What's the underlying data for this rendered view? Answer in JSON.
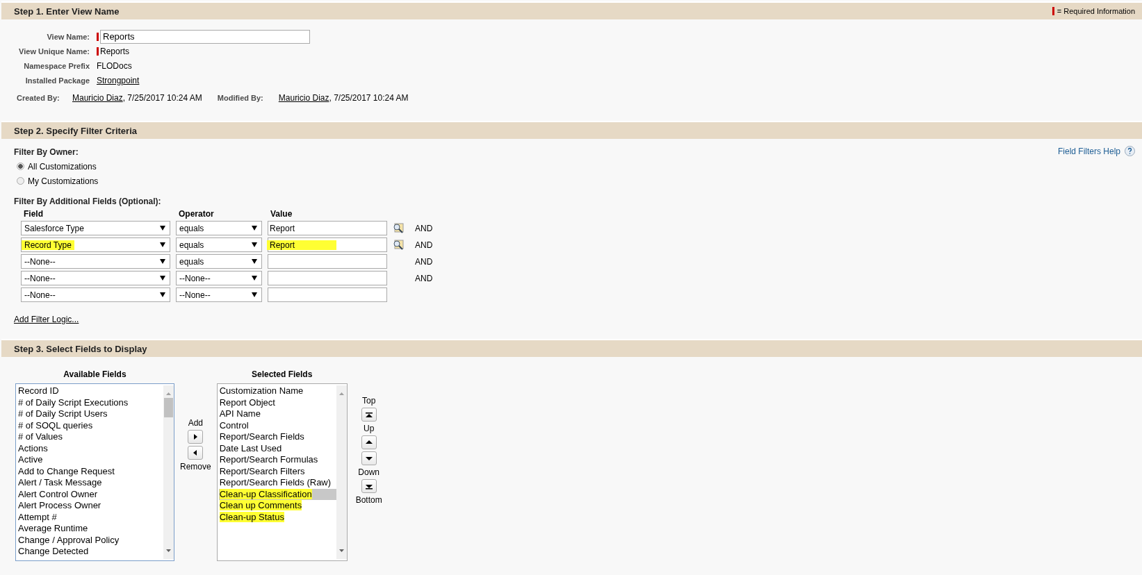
{
  "required_legend": "= Required Information",
  "step1": {
    "title": "Step 1. Enter View Name",
    "fields": [
      {
        "label": "View Name:",
        "kind": "input",
        "value": "Reports",
        "required": true
      },
      {
        "label": "View Unique Name:",
        "kind": "text",
        "value": "Reports",
        "required": true
      },
      {
        "label": "Namespace Prefix",
        "kind": "text",
        "value": "FLODocs",
        "required": false
      },
      {
        "label": "Installed Package",
        "kind": "link",
        "value": "Strongpoint",
        "required": false
      }
    ],
    "audit": [
      {
        "label": "Created By:",
        "user": "Mauricio Diaz",
        "date": ", 7/25/2017 10:24 AM"
      },
      {
        "label": "Modified By:",
        "user": "Mauricio Diaz",
        "date": ", 7/25/2017 10:24 AM"
      }
    ]
  },
  "step2": {
    "title": "Step 2. Specify Filter Criteria",
    "help_link": "Field Filters Help",
    "owner_label": "Filter By Owner:",
    "owner_options": [
      {
        "label": "All Customizations",
        "selected": true
      },
      {
        "label": "My Customizations",
        "selected": false
      }
    ],
    "additional_label": "Filter By Additional Fields (Optional):",
    "columns": [
      "Field",
      "Operator",
      "Value"
    ],
    "rows": [
      {
        "field": "Salesforce Type",
        "operator": "equals",
        "value": "Report",
        "lookup": true,
        "connector": "AND",
        "highlighted": false
      },
      {
        "field": "Record Type",
        "operator": "equals",
        "value": "Report",
        "lookup": true,
        "connector": "AND",
        "highlighted": true
      },
      {
        "field": "--None--",
        "operator": "equals",
        "lookup": false,
        "connector": "AND",
        "highlighted": false
      },
      {
        "field": "--None--",
        "operator": "--None--",
        "lookup": false,
        "connector": "AND",
        "highlighted": false
      },
      {
        "field": "--None--",
        "operator": "--None--",
        "lookup": false,
        "highlighted": false
      }
    ],
    "logic_link": "Add Filter Logic..."
  },
  "step3": {
    "title": "Step 3. Select Fields to Display",
    "available": {
      "title": "Available Fields",
      "items": [
        {
          "label": "Record ID"
        },
        {
          "label": "# of Daily Script Executions"
        },
        {
          "label": "# of Daily Script Users"
        },
        {
          "label": "# of SOQL queries"
        },
        {
          "label": "# of Values"
        },
        {
          "label": "Actions"
        },
        {
          "label": "Active"
        },
        {
          "label": "Add to Change Request"
        },
        {
          "label": "Alert / Task Message"
        },
        {
          "label": "Alert Control Owner"
        },
        {
          "label": "Alert Process Owner"
        },
        {
          "label": "Attempt #"
        },
        {
          "label": "Average Runtime"
        },
        {
          "label": "Change / Approval Policy"
        },
        {
          "label": "Change Detected"
        }
      ]
    },
    "selected_fields": {
      "title": "Selected Fields",
      "items": [
        {
          "label": "Customization Name",
          "selected": false,
          "highlighted": false
        },
        {
          "label": "Report Object",
          "selected": false,
          "highlighted": false
        },
        {
          "label": "API Name",
          "selected": false,
          "highlighted": false
        },
        {
          "label": "Control",
          "selected": false,
          "highlighted": false
        },
        {
          "label": "Report/Search Fields",
          "selected": false,
          "highlighted": false
        },
        {
          "label": "Date Last Used",
          "selected": false,
          "highlighted": false
        },
        {
          "label": "Report/Search Formulas",
          "selected": false,
          "highlighted": false
        },
        {
          "label": "Report/Search Filters",
          "selected": false,
          "highlighted": false
        },
        {
          "label": "Report/Search Fields (Raw)",
          "selected": false,
          "highlighted": false
        },
        {
          "label": "Clean-up Classification",
          "selected": true,
          "highlighted": true
        },
        {
          "label": "Clean up Comments",
          "selected": false,
          "highlighted": true
        },
        {
          "label": "Clean-up Status",
          "selected": false,
          "highlighted": true
        }
      ]
    },
    "add_label": "Add",
    "remove_label": "Remove",
    "order_labels": [
      "Top",
      "Up",
      "Down",
      "Bottom"
    ]
  }
}
